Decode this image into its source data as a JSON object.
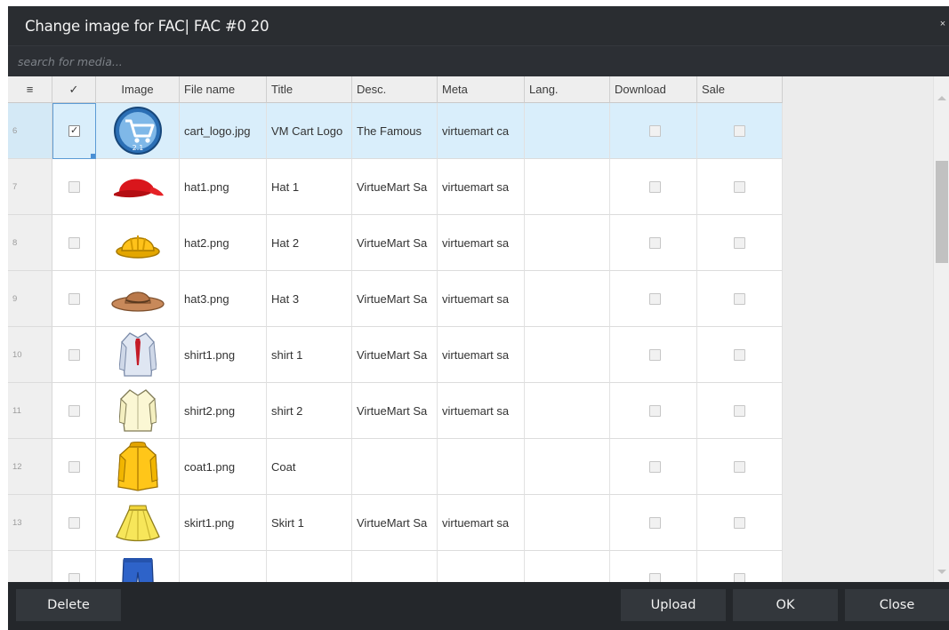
{
  "dialog": {
    "title": "Change image for FAC| FAC #0 20",
    "close_label": "×"
  },
  "search": {
    "placeholder": "search for media..."
  },
  "columns": {
    "menu": "≡",
    "check": "✓",
    "image": "Image",
    "file_name": "File name",
    "title": "Title",
    "desc": "Desc.",
    "meta": "Meta",
    "lang": "Lang.",
    "download": "Download",
    "sale": "Sale"
  },
  "rows": [
    {
      "num": "6",
      "checked": true,
      "image_icon": "cart-logo-icon",
      "file_name": "cart_logo.jpg",
      "title": "VM Cart Logo",
      "desc": "The Famous",
      "meta": "virtuemart ca",
      "lang": "",
      "download": false,
      "sale": false
    },
    {
      "num": "7",
      "checked": false,
      "image_icon": "red-cap-icon",
      "file_name": "hat1.png",
      "title": "Hat 1",
      "desc": "VirtueMart Sa",
      "meta": "virtuemart sa",
      "lang": "",
      "download": false,
      "sale": false
    },
    {
      "num": "8",
      "checked": false,
      "image_icon": "hard-hat-icon",
      "file_name": "hat2.png",
      "title": "Hat 2",
      "desc": "VirtueMart Sa",
      "meta": "virtuemart sa",
      "lang": "",
      "download": false,
      "sale": false
    },
    {
      "num": "9",
      "checked": false,
      "image_icon": "cowboy-hat-icon",
      "file_name": "hat3.png",
      "title": "Hat 3",
      "desc": "VirtueMart Sa",
      "meta": "virtuemart sa",
      "lang": "",
      "download": false,
      "sale": false
    },
    {
      "num": "10",
      "checked": false,
      "image_icon": "shirt-tie-icon",
      "file_name": "shirt1.png",
      "title": "shirt 1",
      "desc": "VirtueMart Sa",
      "meta": "virtuemart sa",
      "lang": "",
      "download": false,
      "sale": false
    },
    {
      "num": "11",
      "checked": false,
      "image_icon": "shirt-icon",
      "file_name": "shirt2.png",
      "title": "shirt 2",
      "desc": "VirtueMart Sa",
      "meta": "virtuemart sa",
      "lang": "",
      "download": false,
      "sale": false
    },
    {
      "num": "12",
      "checked": false,
      "image_icon": "coat-icon",
      "file_name": "coat1.png",
      "title": "Coat",
      "desc": "",
      "meta": "",
      "lang": "",
      "download": false,
      "sale": false
    },
    {
      "num": "13",
      "checked": false,
      "image_icon": "skirt-icon",
      "file_name": "skirt1.png",
      "title": "Skirt 1",
      "desc": "VirtueMart Sa",
      "meta": "virtuemart sa",
      "lang": "",
      "download": false,
      "sale": false
    },
    {
      "num": "",
      "checked": false,
      "image_icon": "jeans-icon",
      "file_name": "",
      "title": "",
      "desc": "",
      "meta": "",
      "lang": "",
      "download": false,
      "sale": false
    }
  ],
  "footer": {
    "delete_label": "Delete",
    "upload_label": "Upload",
    "ok_label": "OK",
    "close_label": "Close"
  },
  "colors": {
    "dialog_bg": "#24272b",
    "selected_row": "#d9eefb",
    "button_bg": "#33373c"
  }
}
